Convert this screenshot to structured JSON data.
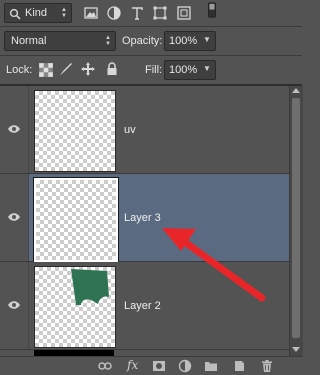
{
  "filter": {
    "kind_label": "Kind",
    "icons": [
      "image-filter-icon",
      "adjustment-filter-icon",
      "type-filter-icon",
      "shape-filter-icon",
      "smart-object-filter-icon",
      "filter-toggle-icon"
    ]
  },
  "blend": {
    "mode": "Normal",
    "opacity_label": "Opacity:",
    "opacity_value": "100%"
  },
  "lock": {
    "label": "Lock:",
    "fill_label": "Fill:",
    "fill_value": "100%",
    "icons": [
      "lock-transparent-pixels-icon",
      "lock-image-pixels-icon",
      "lock-position-icon",
      "lock-all-icon"
    ]
  },
  "layers": [
    {
      "name": "uv",
      "selected": false,
      "visible": true
    },
    {
      "name": "Layer 3",
      "selected": true,
      "visible": true
    },
    {
      "name": "Layer 2",
      "selected": false,
      "visible": true
    }
  ],
  "bottom_icons": [
    "link-layers-icon",
    "fx-icon",
    "add-mask-icon",
    "new-adjustment-layer-icon",
    "new-group-icon",
    "new-layer-icon",
    "delete-layer-icon"
  ],
  "fx_text": "fx",
  "colors": {
    "panel": "#535353",
    "selected_row": "#5a6a80",
    "arrow": "#e8262a",
    "shape": "#2e7352"
  }
}
